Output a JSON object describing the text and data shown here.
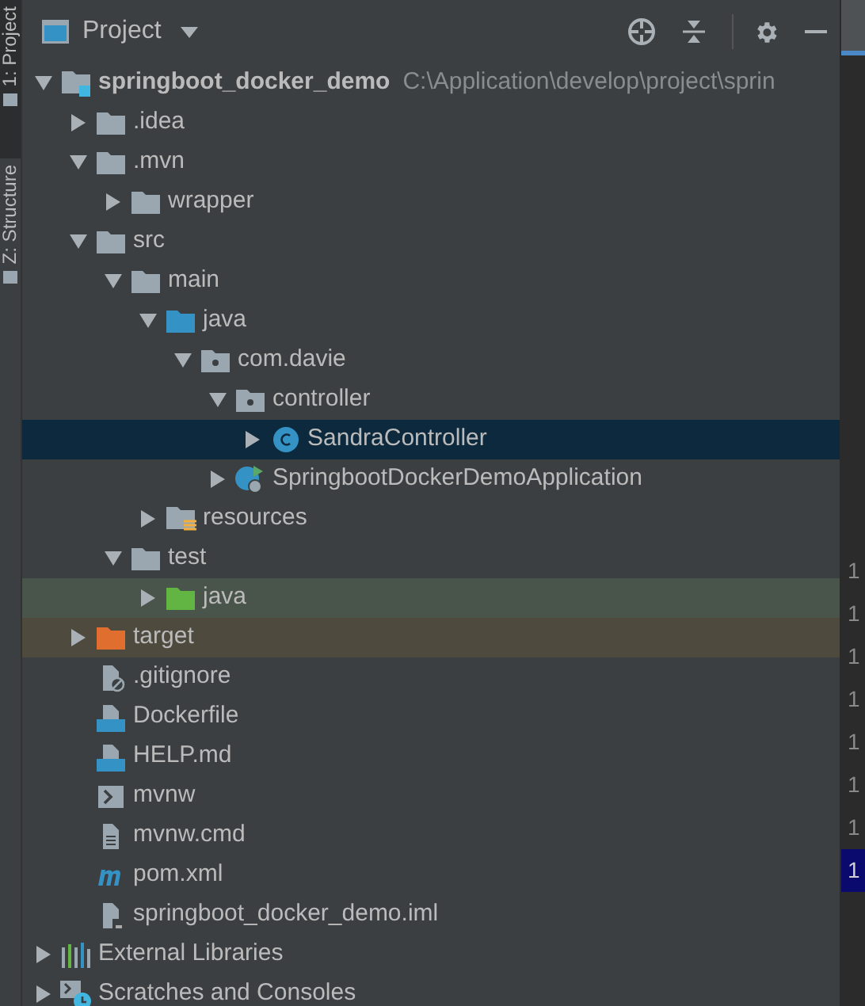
{
  "tool_strip": [
    {
      "label": "1: Project",
      "selected": true
    },
    {
      "label": "Z: Structure",
      "selected": false
    }
  ],
  "panel": {
    "title": "Project"
  },
  "tree": [
    {
      "label": "springboot_docker_demo",
      "path": "C:\\Application\\develop\\project\\sprin",
      "kind": "module",
      "expanded": true,
      "selected": false,
      "children": [
        {
          "label": ".idea",
          "kind": "folder",
          "expanded": false,
          "selected": false
        },
        {
          "label": ".mvn",
          "kind": "folder",
          "expanded": true,
          "selected": false,
          "children": [
            {
              "label": "wrapper",
              "kind": "folder",
              "expanded": false,
              "selected": false
            }
          ]
        },
        {
          "label": "src",
          "kind": "folder",
          "expanded": true,
          "selected": false,
          "children": [
            {
              "label": "main",
              "kind": "folder",
              "expanded": true,
              "selected": false,
              "children": [
                {
                  "label": "java",
                  "kind": "source-folder",
                  "expanded": true,
                  "selected": false,
                  "children": [
                    {
                      "label": "com.davie",
                      "kind": "package",
                      "expanded": true,
                      "selected": false,
                      "children": [
                        {
                          "label": "controller",
                          "kind": "package",
                          "expanded": true,
                          "selected": false,
                          "children": [
                            {
                              "label": "SandraController",
                              "kind": "class",
                              "expanded": false,
                              "selected": true
                            }
                          ]
                        },
                        {
                          "label": "SpringbootDockerDemoApplication",
                          "kind": "spring-app",
                          "expanded": false,
                          "selected": false
                        }
                      ]
                    }
                  ]
                },
                {
                  "label": "resources",
                  "kind": "resources-folder",
                  "expanded": false,
                  "selected": false
                }
              ]
            },
            {
              "label": "test",
              "kind": "folder",
              "expanded": true,
              "selected": false,
              "children": [
                {
                  "label": "java",
                  "kind": "test-folder",
                  "expanded": false,
                  "selected": false
                }
              ]
            }
          ]
        },
        {
          "label": "target",
          "kind": "excluded-folder",
          "expanded": false,
          "selected": false
        },
        {
          "label": ".gitignore",
          "kind": "gitignore",
          "selected": false
        },
        {
          "label": "Dockerfile",
          "kind": "dockerfile",
          "selected": false
        },
        {
          "label": "HELP.md",
          "kind": "markdown",
          "selected": false
        },
        {
          "label": "mvnw",
          "kind": "shell",
          "selected": false
        },
        {
          "label": "mvnw.cmd",
          "kind": "text",
          "selected": false
        },
        {
          "label": "pom.xml",
          "kind": "maven",
          "selected": false
        },
        {
          "label": "springboot_docker_demo.iml",
          "kind": "iml",
          "selected": false
        }
      ]
    },
    {
      "label": "External Libraries",
      "kind": "libraries",
      "expanded": false,
      "selected": false
    },
    {
      "label": "Scratches and Consoles",
      "kind": "scratches",
      "expanded": false,
      "selected": false
    }
  ],
  "gutter": [
    {
      "text": "1",
      "selected": false
    },
    {
      "text": "1",
      "selected": false
    },
    {
      "text": "1",
      "selected": false
    },
    {
      "text": "1",
      "selected": false
    },
    {
      "text": "1",
      "selected": false
    },
    {
      "text": "1",
      "selected": false
    },
    {
      "text": "1",
      "selected": false
    },
    {
      "text": "1",
      "selected": true
    }
  ]
}
